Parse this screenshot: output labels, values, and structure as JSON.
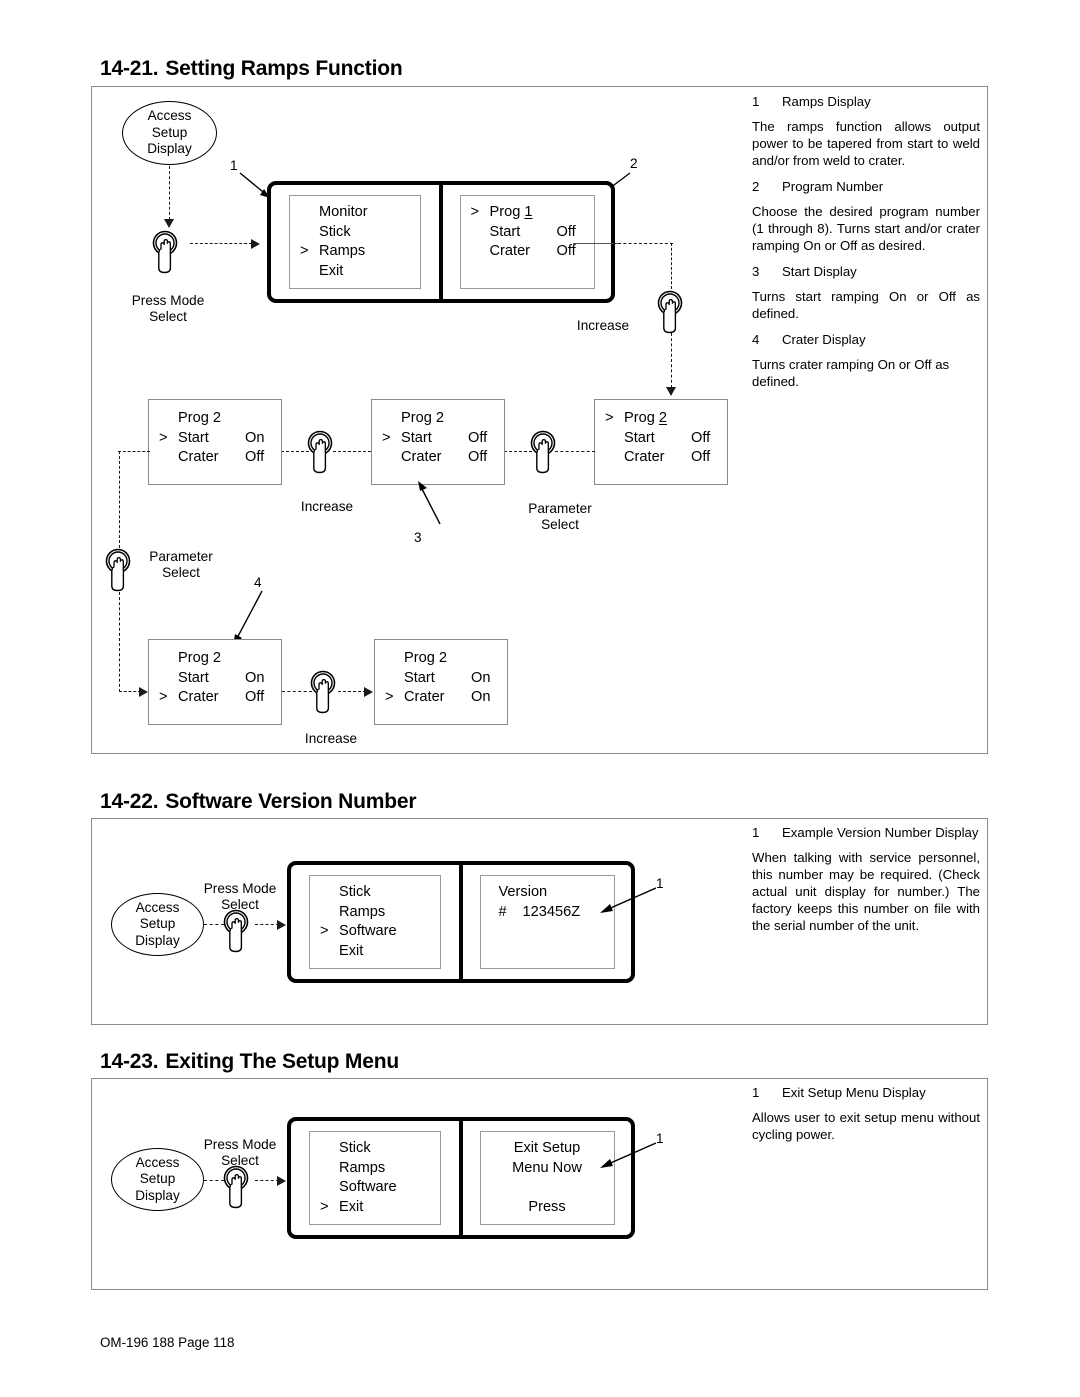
{
  "sections": [
    {
      "number": "14-21.",
      "title": "Setting Ramps Function",
      "callouts": [
        {
          "n": "1",
          "heading": "Ramps Display",
          "body": "The ramps function allows output power to be tapered from start to weld and/or from weld to crater."
        },
        {
          "n": "2",
          "heading": "Program Number",
          "body": "Choose the desired program number (1 through 8). Turns start and/or crater ramping On or Off as desired."
        },
        {
          "n": "3",
          "heading": "Start Display",
          "body": "Turns start ramping On or Off as defined."
        },
        {
          "n": "4",
          "heading": "Crater Display",
          "body": "Turns crater ramping On or Off as defined."
        }
      ]
    },
    {
      "number": "14-22.",
      "title": "Software Version Number",
      "callouts": [
        {
          "n": "1",
          "heading": "Example Version Number Display",
          "body": "When talking with service personnel, this number may be required. (Check actual unit display for number.) The factory keeps this number on file with the serial number of the unit."
        }
      ]
    },
    {
      "number": "14-23.",
      "title": "Exiting The Setup Menu",
      "callouts": [
        {
          "n": "1",
          "heading": "Exit Setup Menu Display",
          "body": "Allows user to exit setup menu without cycling power."
        }
      ]
    }
  ],
  "labels": {
    "access_setup_display": [
      "Access",
      "Setup",
      "Display"
    ],
    "press_mode_select": [
      "Press Mode",
      "Select"
    ],
    "parameter_select": [
      "Parameter",
      "Select"
    ],
    "increase": "Increase",
    "cursor": ">"
  },
  "diagram1": {
    "callout_numbers": {
      "c1": "1",
      "c2": "2",
      "c3": "3",
      "c4": "4"
    },
    "panel": {
      "left_screen": [
        {
          "cur": "",
          "label": "Monitor",
          "value": ""
        },
        {
          "cur": "",
          "label": "Stick",
          "value": ""
        },
        {
          "cur": ">",
          "label": "Ramps",
          "value": ""
        },
        {
          "cur": "",
          "label": "Exit",
          "value": ""
        }
      ],
      "right_screen": [
        {
          "cur": ">",
          "label": "Prog",
          "prog": "1",
          "value": ""
        },
        {
          "cur": "",
          "label": "Start",
          "value": "Off"
        },
        {
          "cur": "",
          "label": "Crater",
          "value": "Off"
        }
      ]
    },
    "box_a": [
      {
        "cur": ">",
        "label": "Prog",
        "prog": "2",
        "value": ""
      },
      {
        "cur": "",
        "label": "Start",
        "value": "Off"
      },
      {
        "cur": "",
        "label": "Crater",
        "value": "Off"
      }
    ],
    "box_b": [
      {
        "cur": "",
        "label": "Prog 2",
        "value": ""
      },
      {
        "cur": ">",
        "label": "Start",
        "value": "Off"
      },
      {
        "cur": "",
        "label": "Crater",
        "value": "Off"
      }
    ],
    "box_c": [
      {
        "cur": "",
        "label": "Prog 2",
        "value": ""
      },
      {
        "cur": ">",
        "label": "Start",
        "value": "On"
      },
      {
        "cur": "",
        "label": "Crater",
        "value": "Off"
      }
    ],
    "box_d": [
      {
        "cur": "",
        "label": "Prog 2",
        "value": ""
      },
      {
        "cur": "",
        "label": "Start",
        "value": "On"
      },
      {
        "cur": ">",
        "label": "Crater",
        "value": "Off"
      }
    ],
    "box_e": [
      {
        "cur": "",
        "label": "Prog 2",
        "value": ""
      },
      {
        "cur": "",
        "label": "Start",
        "value": "On"
      },
      {
        "cur": ">",
        "label": "Crater",
        "value": "On"
      }
    ]
  },
  "diagram2": {
    "callout_number": "1",
    "left_screen": [
      {
        "cur": "",
        "label": "Stick",
        "value": ""
      },
      {
        "cur": "",
        "label": "Ramps",
        "value": ""
      },
      {
        "cur": ">",
        "label": "Software",
        "value": ""
      },
      {
        "cur": "",
        "label": "Exit",
        "value": ""
      }
    ],
    "right_screen": {
      "line1": "Version",
      "line2_prefix": "#",
      "line2_value": "123456Z"
    }
  },
  "diagram3": {
    "callout_number": "1",
    "left_screen": [
      {
        "cur": "",
        "label": "Stick",
        "value": ""
      },
      {
        "cur": "",
        "label": "Ramps",
        "value": ""
      },
      {
        "cur": "",
        "label": "Software",
        "value": ""
      },
      {
        "cur": ">",
        "label": "Exit",
        "value": ""
      }
    ],
    "right_screen": {
      "line1": "Exit Setup",
      "line2": "Menu Now",
      "line3": "",
      "line4": "Press"
    }
  },
  "footer": "OM-196 188 Page 118"
}
